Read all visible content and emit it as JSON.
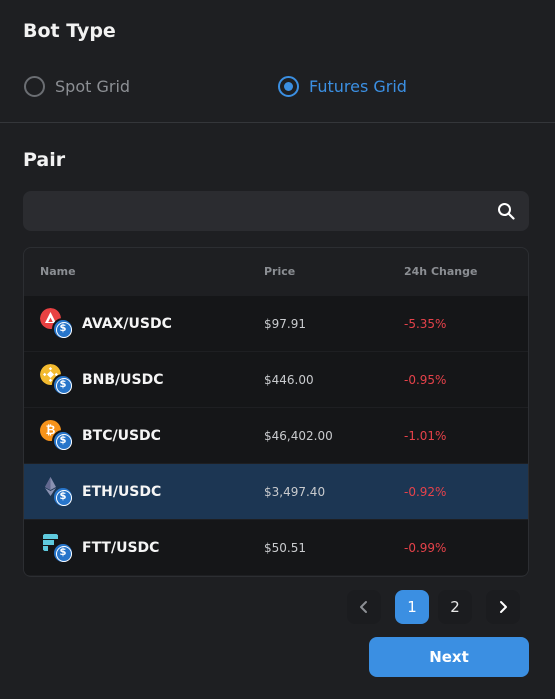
{
  "bot_type": {
    "title": "Bot Type",
    "options": [
      {
        "label": "Spot Grid",
        "selected": false
      },
      {
        "label": "Futures Grid",
        "selected": true
      }
    ]
  },
  "pair": {
    "title": "Pair",
    "search": {
      "value": "",
      "placeholder": "",
      "icon": "search-icon"
    },
    "table": {
      "columns": [
        "Name",
        "Price",
        "24h Change"
      ],
      "rows": [
        {
          "name": "AVAX/USDC",
          "price": "$97.91",
          "change": "-5.35%",
          "icon": "avax-icon",
          "icon_color": "#e84142",
          "selected": false
        },
        {
          "name": "BNB/USDC",
          "price": "$446.00",
          "change": "-0.95%",
          "icon": "bnb-icon",
          "icon_color": "#f3ba2f",
          "selected": false
        },
        {
          "name": "BTC/USDC",
          "price": "$46,402.00",
          "change": "-1.01%",
          "icon": "btc-icon",
          "icon_color": "#f7931a",
          "selected": false
        },
        {
          "name": "ETH/USDC",
          "price": "$3,497.40",
          "change": "-0.92%",
          "icon": "eth-icon",
          "icon_color": "#8a92b2",
          "selected": true
        },
        {
          "name": "FTT/USDC",
          "price": "$50.51",
          "change": "-0.99%",
          "icon": "ftt-icon",
          "icon_color": "#5fcade",
          "selected": false
        }
      ]
    }
  },
  "pagination": {
    "prev_icon": "chevron-left-icon",
    "next_icon": "chevron-right-icon",
    "pages": [
      "1",
      "2"
    ],
    "current": "1"
  },
  "next_button": {
    "label": "Next"
  },
  "colors": {
    "accent": "#3b8fe2",
    "negative": "#e5424a",
    "background": "#1e1f22",
    "selected_row": "#1c3653"
  }
}
